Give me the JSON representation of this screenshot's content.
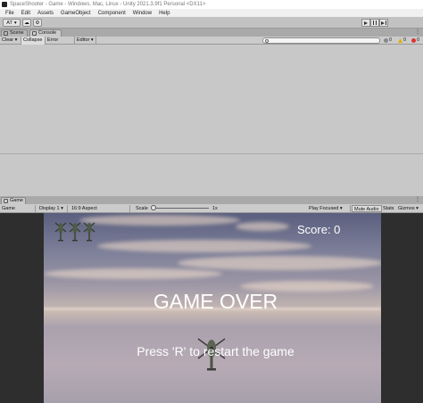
{
  "window": {
    "title": "SpaceShooter - Game - Windows, Mac, Linux - Unity 2021.3.9f1 Personal <DX11>"
  },
  "menu": [
    "File",
    "Edit",
    "Assets",
    "GameObject",
    "Component",
    "Window",
    "Help"
  ],
  "toolbar": {
    "account": "AT",
    "account_icon": "cloud-icon",
    "settings_icon": "gear-icon"
  },
  "upper_tabs": [
    {
      "label": "Scene"
    },
    {
      "label": "Console"
    }
  ],
  "console": {
    "clear": "Clear",
    "collapse": "Collapse",
    "error_pause": "Error Pause",
    "editor": "Editor",
    "search_value": "",
    "log_count": "0",
    "warn_count": "0",
    "error_count": "0"
  },
  "game_tab": {
    "label": "Game"
  },
  "game_toolbar": {
    "view": "Game",
    "display": "Display 1",
    "aspect": "16:9 Aspect",
    "scale_label": "Scale",
    "scale_value": "1x",
    "scale_fraction": 0.0,
    "play_focused": "Play Focused",
    "mute": "Mute Audio",
    "stats": "Stats",
    "gizmos": "Gizmos"
  },
  "game": {
    "score_text": "Score: 0",
    "game_over": "GAME OVER",
    "restart": "Press 'R' to restart the game",
    "lives": 3
  },
  "colors": {
    "viewport_bg": "#2e2e2e",
    "text": "#ffffff"
  }
}
